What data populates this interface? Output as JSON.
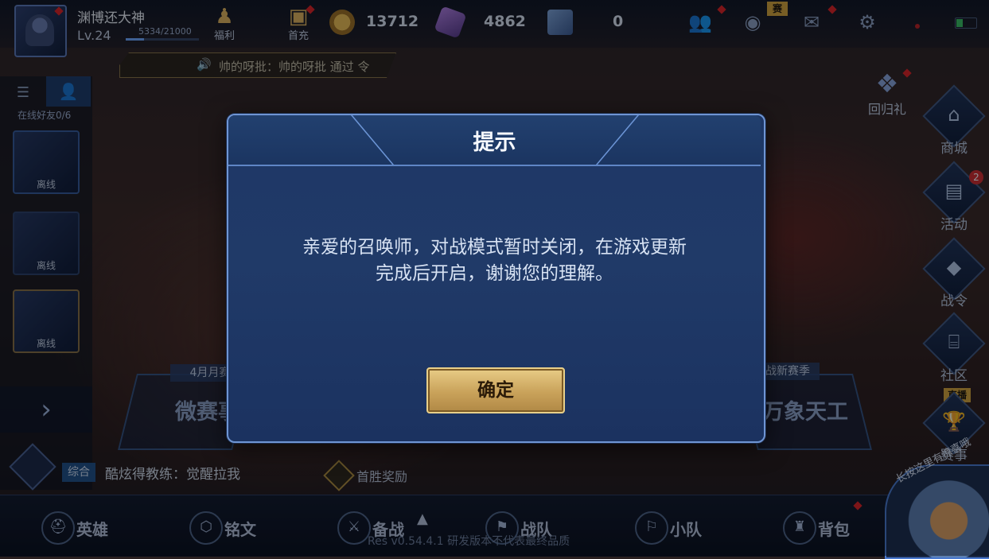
{
  "player": {
    "name": "渊博还大神",
    "level": "Lv.24",
    "exp_text": "5334/21000",
    "exp_fraction": 0.25
  },
  "top": {
    "welfare_label": "福利",
    "first_charge_label": "首充",
    "gold": "13712",
    "diamonds": "4862",
    "coupons": "0",
    "season_tag": "赛"
  },
  "marquee": {
    "text": "帅的呀批：帅的呀批 通过 令"
  },
  "friends": {
    "online_count": "在线好友0/6",
    "slots": [
      "离线",
      "离线",
      "离线"
    ]
  },
  "side_menu": {
    "return_gift": "回归礼",
    "shop": "商城",
    "activity": "活动",
    "activity_badge": "2",
    "battle_pass": "战令",
    "community": "社区",
    "events": "赛事",
    "live_tag": "直播"
  },
  "banners": {
    "left_tag": "4月月赛",
    "left_title": "微赛事",
    "right_tag": "战新赛季",
    "right_title": "万象天工"
  },
  "chat": {
    "channel": "综合",
    "text": "酷炫得教练：觉醒拉我"
  },
  "first_win": "首胜奖励",
  "bottom_nav": {
    "heroes": "英雄",
    "runes": "铭文",
    "prepare": "备战",
    "team": "战队",
    "squad": "小队",
    "bag": "背包"
  },
  "version": "Res v0.54.4.1 研发版本不代表最终品质",
  "mascot_text": "长按这里有惊喜哦",
  "dialog": {
    "title": "提示",
    "message_line1": "亲爱的召唤师，对战模式暂时关闭，在游戏更新",
    "message_line2": "完成后开启，谢谢您的理解。",
    "confirm": "确定"
  },
  "colors": {
    "dialog_bg": "#203a68",
    "dialog_border": "#6f95d4",
    "button_gold": "#c9a25a"
  }
}
